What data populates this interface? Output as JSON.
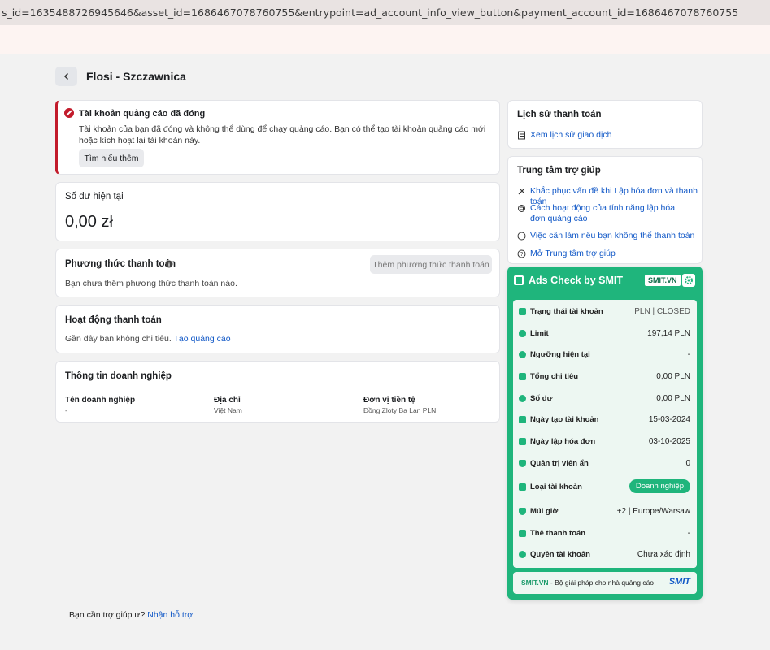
{
  "browser": {
    "url": "s_id=1635488726945646&asset_id=1686467078760755&entrypoint=ad_account_info_view_button&payment_account_id=1686467078760755"
  },
  "header": {
    "title": "Flosi - Szczawnica"
  },
  "alert": {
    "title": "Tài khoản quảng cáo đã đóng",
    "body": "Tài khoản của bạn đã đóng và không thể dùng để chạy quảng cáo. Bạn có thể tạo tài khoản quảng cáo mới hoặc kích hoạt lại tài khoản này.",
    "button": "Tìm hiểu thêm"
  },
  "balance": {
    "title": "Số dư hiện tại",
    "amount": "0,00 zł"
  },
  "payment_method": {
    "title": "Phương thức thanh toán",
    "button": "Thêm phương thức thanh toán",
    "empty": "Bạn chưa thêm phương thức thanh toán nào."
  },
  "activity": {
    "title": "Hoạt động thanh toán",
    "text": "Gần đây bạn không chi tiêu.",
    "link": "Tạo quảng cáo"
  },
  "business": {
    "title": "Thông tin doanh nghiệp",
    "columns": [
      {
        "label": "Tên doanh nghiệp",
        "value": "-"
      },
      {
        "label": "Địa chỉ",
        "value": "Việt Nam"
      },
      {
        "label": "Đơn vị tiền tệ",
        "value": "Đồng Zloty Ba Lan PLN"
      }
    ]
  },
  "history": {
    "title": "Lịch sử thanh toán",
    "link": "Xem lịch sử giao dịch"
  },
  "help_center": {
    "title": "Trung tâm trợ giúp",
    "items": [
      "Khắc phục vấn đề khi Lập hóa đơn và thanh toán",
      "Cách hoạt động của tính năng lập hóa đơn quảng cáo",
      "Việc cần làm nếu bạn không thể thanh toán",
      "Mở Trung tâm trợ giúp"
    ]
  },
  "smit": {
    "title": "Ads Check by SMIT",
    "badge": "SMIT.VN",
    "rows": [
      {
        "label": "Trạng thái tài khoản",
        "value": "PLN | CLOSED"
      },
      {
        "label": "Limit",
        "value": "197,14 PLN"
      },
      {
        "label": "Ngưỡng hiện tại",
        "value": "-"
      },
      {
        "label": "Tổng chi tiêu",
        "value": "0,00 PLN"
      },
      {
        "label": "Số dư",
        "value": "0,00 PLN"
      },
      {
        "label": "Ngày tạo tài khoản",
        "value": "15-03-2024"
      },
      {
        "label": "Ngày lập hóa đơn",
        "value": "03-10-2025"
      },
      {
        "label": "Quản trị viên ẩn",
        "value": "0"
      },
      {
        "label": "Loại tài khoản",
        "value": "Doanh nghiệp"
      },
      {
        "label": "Múi giờ",
        "value": "+2 | Europe/Warsaw"
      },
      {
        "label": "Thẻ thanh toán",
        "value": "-"
      },
      {
        "label": "Quyền tài khoản",
        "value": "Chưa xác định"
      }
    ],
    "footer_brand": "SMIT.VN",
    "footer_text": " - Bộ giải pháp cho nhà quảng cáo",
    "footer_logo": "SMIT"
  },
  "footer": {
    "text": "Bạn cần trợ giúp ư?",
    "link": "Nhận hỗ trợ"
  },
  "colors": {
    "accent": "#1fb57c",
    "error": "#c21b2b",
    "link": "#1158c7"
  }
}
